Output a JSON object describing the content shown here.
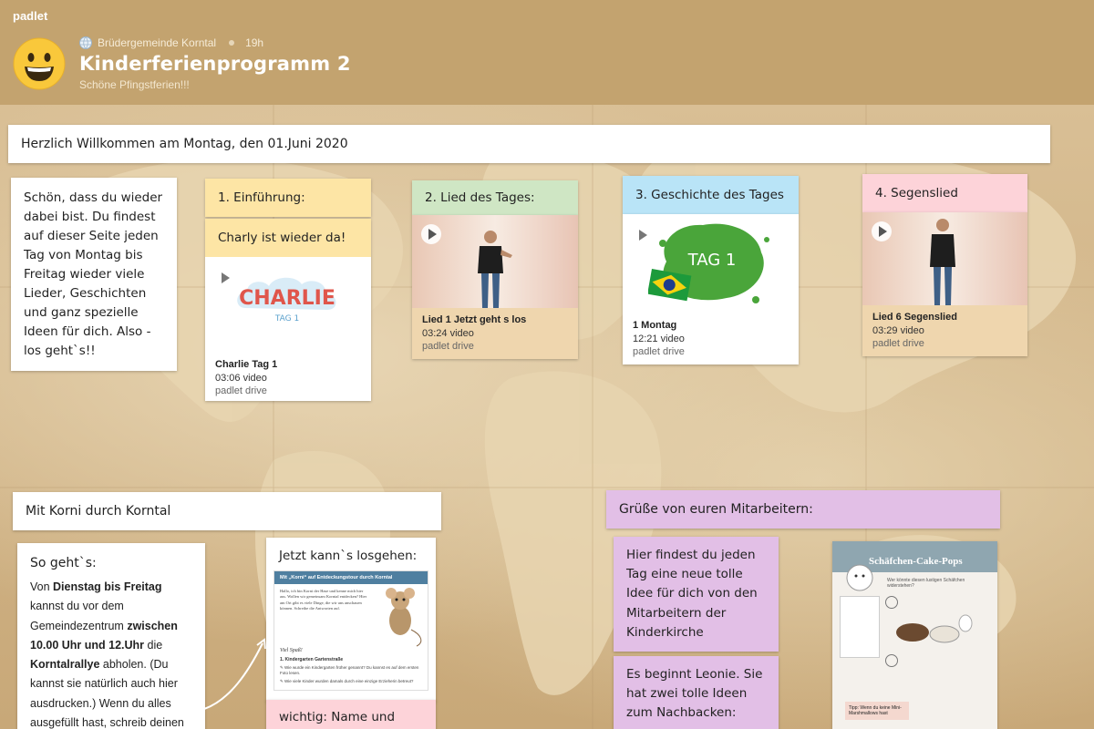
{
  "app": {
    "brand": "padlet"
  },
  "header": {
    "author": "Brüdergemeinde Korntal",
    "time_ago": "19h",
    "title": "Kinderferienprogramm 2",
    "subtitle": "Schöne Pfingstferien!!!"
  },
  "sections": {
    "monday": "Herzlich Willkommen am Montag, den 01.Juni 2020",
    "korni": "Mit Korni durch Korntal",
    "greetings": "Grüße von euren Mitarbeitern:"
  },
  "welcome_note": "Schön, dass du wieder dabei bist. Du findest auf dieser Seite jeden Tag von Montag bis Freitag wieder viele Lieder, Geschichten und ganz spezielle Ideen für dich. Also - los geht`s!!",
  "columns": [
    {
      "header": "1. Einführung:",
      "subtitle": "Charly ist wieder da!",
      "thumb_text": "CHARLIE",
      "thumb_sub": "TAG 1",
      "video_title": "Charlie Tag 1",
      "video_meta": "03:06 video",
      "video_source": "padlet drive"
    },
    {
      "header": "2. Lied des Tages:",
      "video_title": "Lied 1 Jetzt geht s los",
      "video_meta": "03:24 video",
      "video_source": "padlet drive"
    },
    {
      "header": "3. Geschichte des Tages",
      "thumb_text": "TAG 1",
      "video_title": "1 Montag",
      "video_meta": "12:21 video",
      "video_source": "padlet drive"
    },
    {
      "header": "4. Segenslied",
      "video_title": "Lied 6 Segenslied",
      "video_meta": "03:29 video",
      "video_source": "padlet drive"
    }
  ],
  "korni": {
    "heading": "So geht`s:",
    "lines": [
      [
        "Von ",
        "Dienstag bis Freitag"
      ],
      [
        "kannst du vor dem"
      ],
      [
        "Gemeindezentrum ",
        "zwischen"
      ],
      [
        "10.00 Uhr und 12.Uhr",
        " die"
      ],
      [
        "Korntalrallye",
        " abholen. (Du"
      ],
      [
        "kannst sie natürlich auch hier"
      ],
      [
        "ausdrucken.) Wenn du alles"
      ],
      [
        "ausgefüllt hast, schreib deinen"
      ]
    ],
    "jetzt_header": "Jetzt kann`s losgehen:",
    "doc_title": "Mit „Korni“ auf Entdeckungstour durch Korntal",
    "doc_para": "Hallo, ich bin Korni der Hase und kenne mich hier aus. Wollen wir gemeinsam Korntal entdecken? Hier am Ort gibt es viele Dinge, die wir uns anschauen können. Schreibe die Antworten auf.",
    "doc_spass": "Viel Spaß!",
    "doc_item_1": "1. Kindergarten Gartenstraße",
    "doc_q1": "Wie wurde ein Kindergarten früher genannt? Du kannst es auf dem ersten Foto lesen.",
    "doc_q2": "Wie viele Kinder wurden damals durch eine einzige Erzieherin betreut?",
    "wichtig": "wichtig: Name und"
  },
  "greetings": {
    "note1": "Hier findest du jeden Tag eine neue tolle Idee für dich von den Mitarbeitern der Kinderkirche",
    "note2": "Es beginnt Leonie. Sie hat zwei tolle Ideen zum Nachbacken:",
    "recipe_title": "Schäfchen-Cake-Pops",
    "recipe_intro": "Wer könnte diesen lustigen Schäfchen widerstehen?",
    "recipe_step": "Tipp: Wenn du keine Mini-Marshmallows hast"
  },
  "colors": {
    "header_bg": "#c3a36f",
    "yellow": "#fde5a5",
    "green": "#cfe6c4",
    "blue": "#b9e4f7",
    "pink": "#fdd3d9",
    "lilac": "#e2bfe6"
  }
}
